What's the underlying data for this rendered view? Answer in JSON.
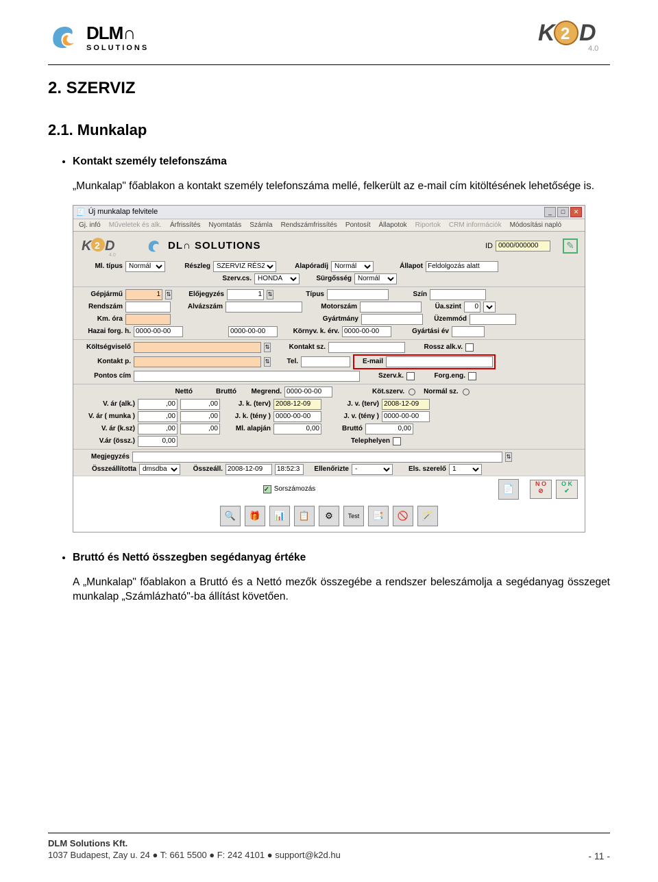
{
  "header": {
    "logo_text": "DLM",
    "logo_sub": "SOLUTIONS",
    "k2d": "K2D",
    "k2d_ver": "4.0"
  },
  "content": {
    "h1": "2.    SZERVIZ",
    "h2": "2.1.  Munkalap",
    "bullet1": "Kontakt személy telefonszáma",
    "para1": "„Munkalap\" főablakon a kontakt személy telefonszáma mellé, felkerült az e-mail cím kitöltésének lehetősége is.",
    "bullet2": "Bruttó és Nettó összegben segédanyag értéke",
    "para2": "A „Munkalap\" főablakon a Bruttó és a Nettó mezők összegébe a rendszer beleszámolja a segédanyag összeget munkalap „Számlázható\"-ba állítást követően."
  },
  "window": {
    "title": "Új munkalap felvitele",
    "menu": [
      "Gj. infó",
      "Műveletek és alk.",
      "Árfrissítés",
      "Nyomtatás",
      "Számla",
      "Rendszámfrissítés",
      "Pontosít",
      "Állapotok",
      "Riportok",
      "CRM információk",
      "Módosítási napló"
    ],
    "id_label": "ID",
    "id_value": "0000/000000",
    "row1": {
      "ml_tipus": "Ml. típus",
      "ml_val": "Normál",
      "reszleg": "Részleg",
      "reszleg_val": "SZERVIZ RÉSZ",
      "alaporadij": "Alapóradíj",
      "alap_val": "Normál",
      "allapot": "Állapot",
      "allapot_val": "Feldolgozás alatt"
    },
    "row1b": {
      "szervcs": "Szerv.cs.",
      "szervcs_val": "HONDA",
      "surgosseg": "Sürgősség",
      "surg_val": "Normál"
    },
    "row2": {
      "gepjarmu": "Gépjármű",
      "gep_val": "1",
      "elojegyzes": "Előjegyzés",
      "elo_val": "1",
      "tipus": "Típus",
      "szin": "Szín"
    },
    "row3": {
      "rendszam": "Rendszám",
      "alvazszam": "Alvázszám",
      "motorszam": "Motorszám",
      "uaszint": "Üa.szint",
      "ua_val": "0"
    },
    "row4": {
      "kmora": "Km. óra",
      "gyartmany": "Gyártmány",
      "uzemmod": "Üzemmód"
    },
    "row5": {
      "hazai": "Hazai forg. h.",
      "hazai_val": "0000-00-00",
      "hazai2_val": "0000-00-00",
      "kornyv": "Környv. k. érv.",
      "kornyv_val": "0000-00-00",
      "gyartasi": "Gyártási év"
    },
    "row6": {
      "koltsegviselo": "Költségviselő",
      "kontakt_sz": "Kontakt sz.",
      "rossz": "Rossz alk.v."
    },
    "row7": {
      "kontakt_p": "Kontakt p.",
      "tel": "Tel.",
      "email": "E-mail"
    },
    "row8": {
      "pontos": "Pontos cím",
      "szervk": "Szerv.k.",
      "forgeng": "Forg.eng."
    },
    "hdr": {
      "netto": "Nettó",
      "brutto": "Bruttó",
      "megrend": "Megrend.",
      "megrend_val": "0000-00-00",
      "kotszerv": "Köt.szerv.",
      "normalsz": "Normál sz."
    },
    "r1": {
      "var_alk": "V. ár (alk.)",
      "n": ",00",
      "b": ",00",
      "jkterv": "J. k. (terv)",
      "jkterv_val": "2008-12-09",
      "jvterv": "J. v. (terv)",
      "jvterv_val": "2008-12-09"
    },
    "r2": {
      "var_munka": "V. ár ( munka )",
      "n": ",00",
      "b": ",00",
      "jkteny": "J. k. (tény )",
      "jkteny_val": "0000-00-00",
      "jvteny": "J. v. (tény )",
      "jvteny_val": "0000-00-00"
    },
    "r3": {
      "var_ksz": "V. ár (k.sz)",
      "n": ",00",
      "b": ",00",
      "mlalap": "Ml. alapján",
      "mlalap_val": "0,00",
      "brutto": "Bruttó",
      "brutto_val": "0,00"
    },
    "r4": {
      "var_ossz": "V.ár (össz.)",
      "n": "0,00",
      "telep": "Telephelyen"
    },
    "megj": "Megjegyzés",
    "ossze": {
      "osszeall_lbl": "Összeállította",
      "osszeall_val": "dmsdba",
      "osszeall2": "Összeáll.",
      "date": "2008-12-09",
      "time": "18:52:3",
      "ellen": "Ellenőrizte",
      "ellen_val": "-",
      "elsszer": "Els. szerelő",
      "elsszer_val": "1"
    },
    "sorszam": "Sorszámozás",
    "test": "Test",
    "ok": "O K",
    "no": "N O"
  },
  "footer": {
    "company": "DLM Solutions Kft.",
    "address": "1037 Budapest, Zay u. 24  ●  T: 661 5500  ●  F: 242 4101  ●  support@k2d.hu",
    "page": "- 11 -"
  }
}
